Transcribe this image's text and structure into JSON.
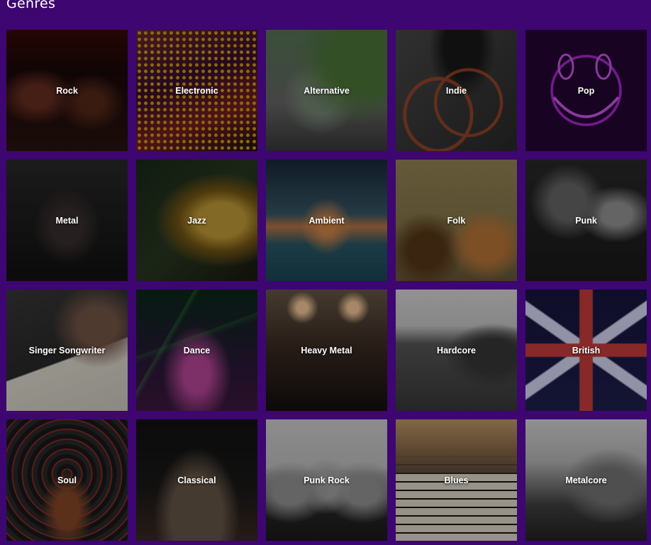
{
  "page": {
    "title": "Genres"
  },
  "genres": [
    {
      "label": "Rock",
      "icon": "rock-art"
    },
    {
      "label": "Electronic",
      "icon": "electronic-art"
    },
    {
      "label": "Alternative",
      "icon": "alternative-art"
    },
    {
      "label": "Indie",
      "icon": "indie-art"
    },
    {
      "label": "Pop",
      "icon": "pop-art"
    },
    {
      "label": "Metal",
      "icon": "metal-art"
    },
    {
      "label": "Jazz",
      "icon": "jazz-art"
    },
    {
      "label": "Ambient",
      "icon": "ambient-art"
    },
    {
      "label": "Folk",
      "icon": "folk-art"
    },
    {
      "label": "Punk",
      "icon": "punk-art"
    },
    {
      "label": "Singer Songwriter",
      "icon": "singer-songwriter-art"
    },
    {
      "label": "Dance",
      "icon": "dance-art"
    },
    {
      "label": "Heavy Metal",
      "icon": "heavy-metal-art"
    },
    {
      "label": "Hardcore",
      "icon": "hardcore-art"
    },
    {
      "label": "British",
      "icon": "british-art"
    },
    {
      "label": "Soul",
      "icon": "soul-art"
    },
    {
      "label": "Classical",
      "icon": "classical-art"
    },
    {
      "label": "Punk Rock",
      "icon": "punk-rock-art"
    },
    {
      "label": "Blues",
      "icon": "blues-art"
    },
    {
      "label": "Metalcore",
      "icon": "metalcore-art"
    }
  ],
  "colors": {
    "background": "#3d0671",
    "label": "#ffffff"
  }
}
